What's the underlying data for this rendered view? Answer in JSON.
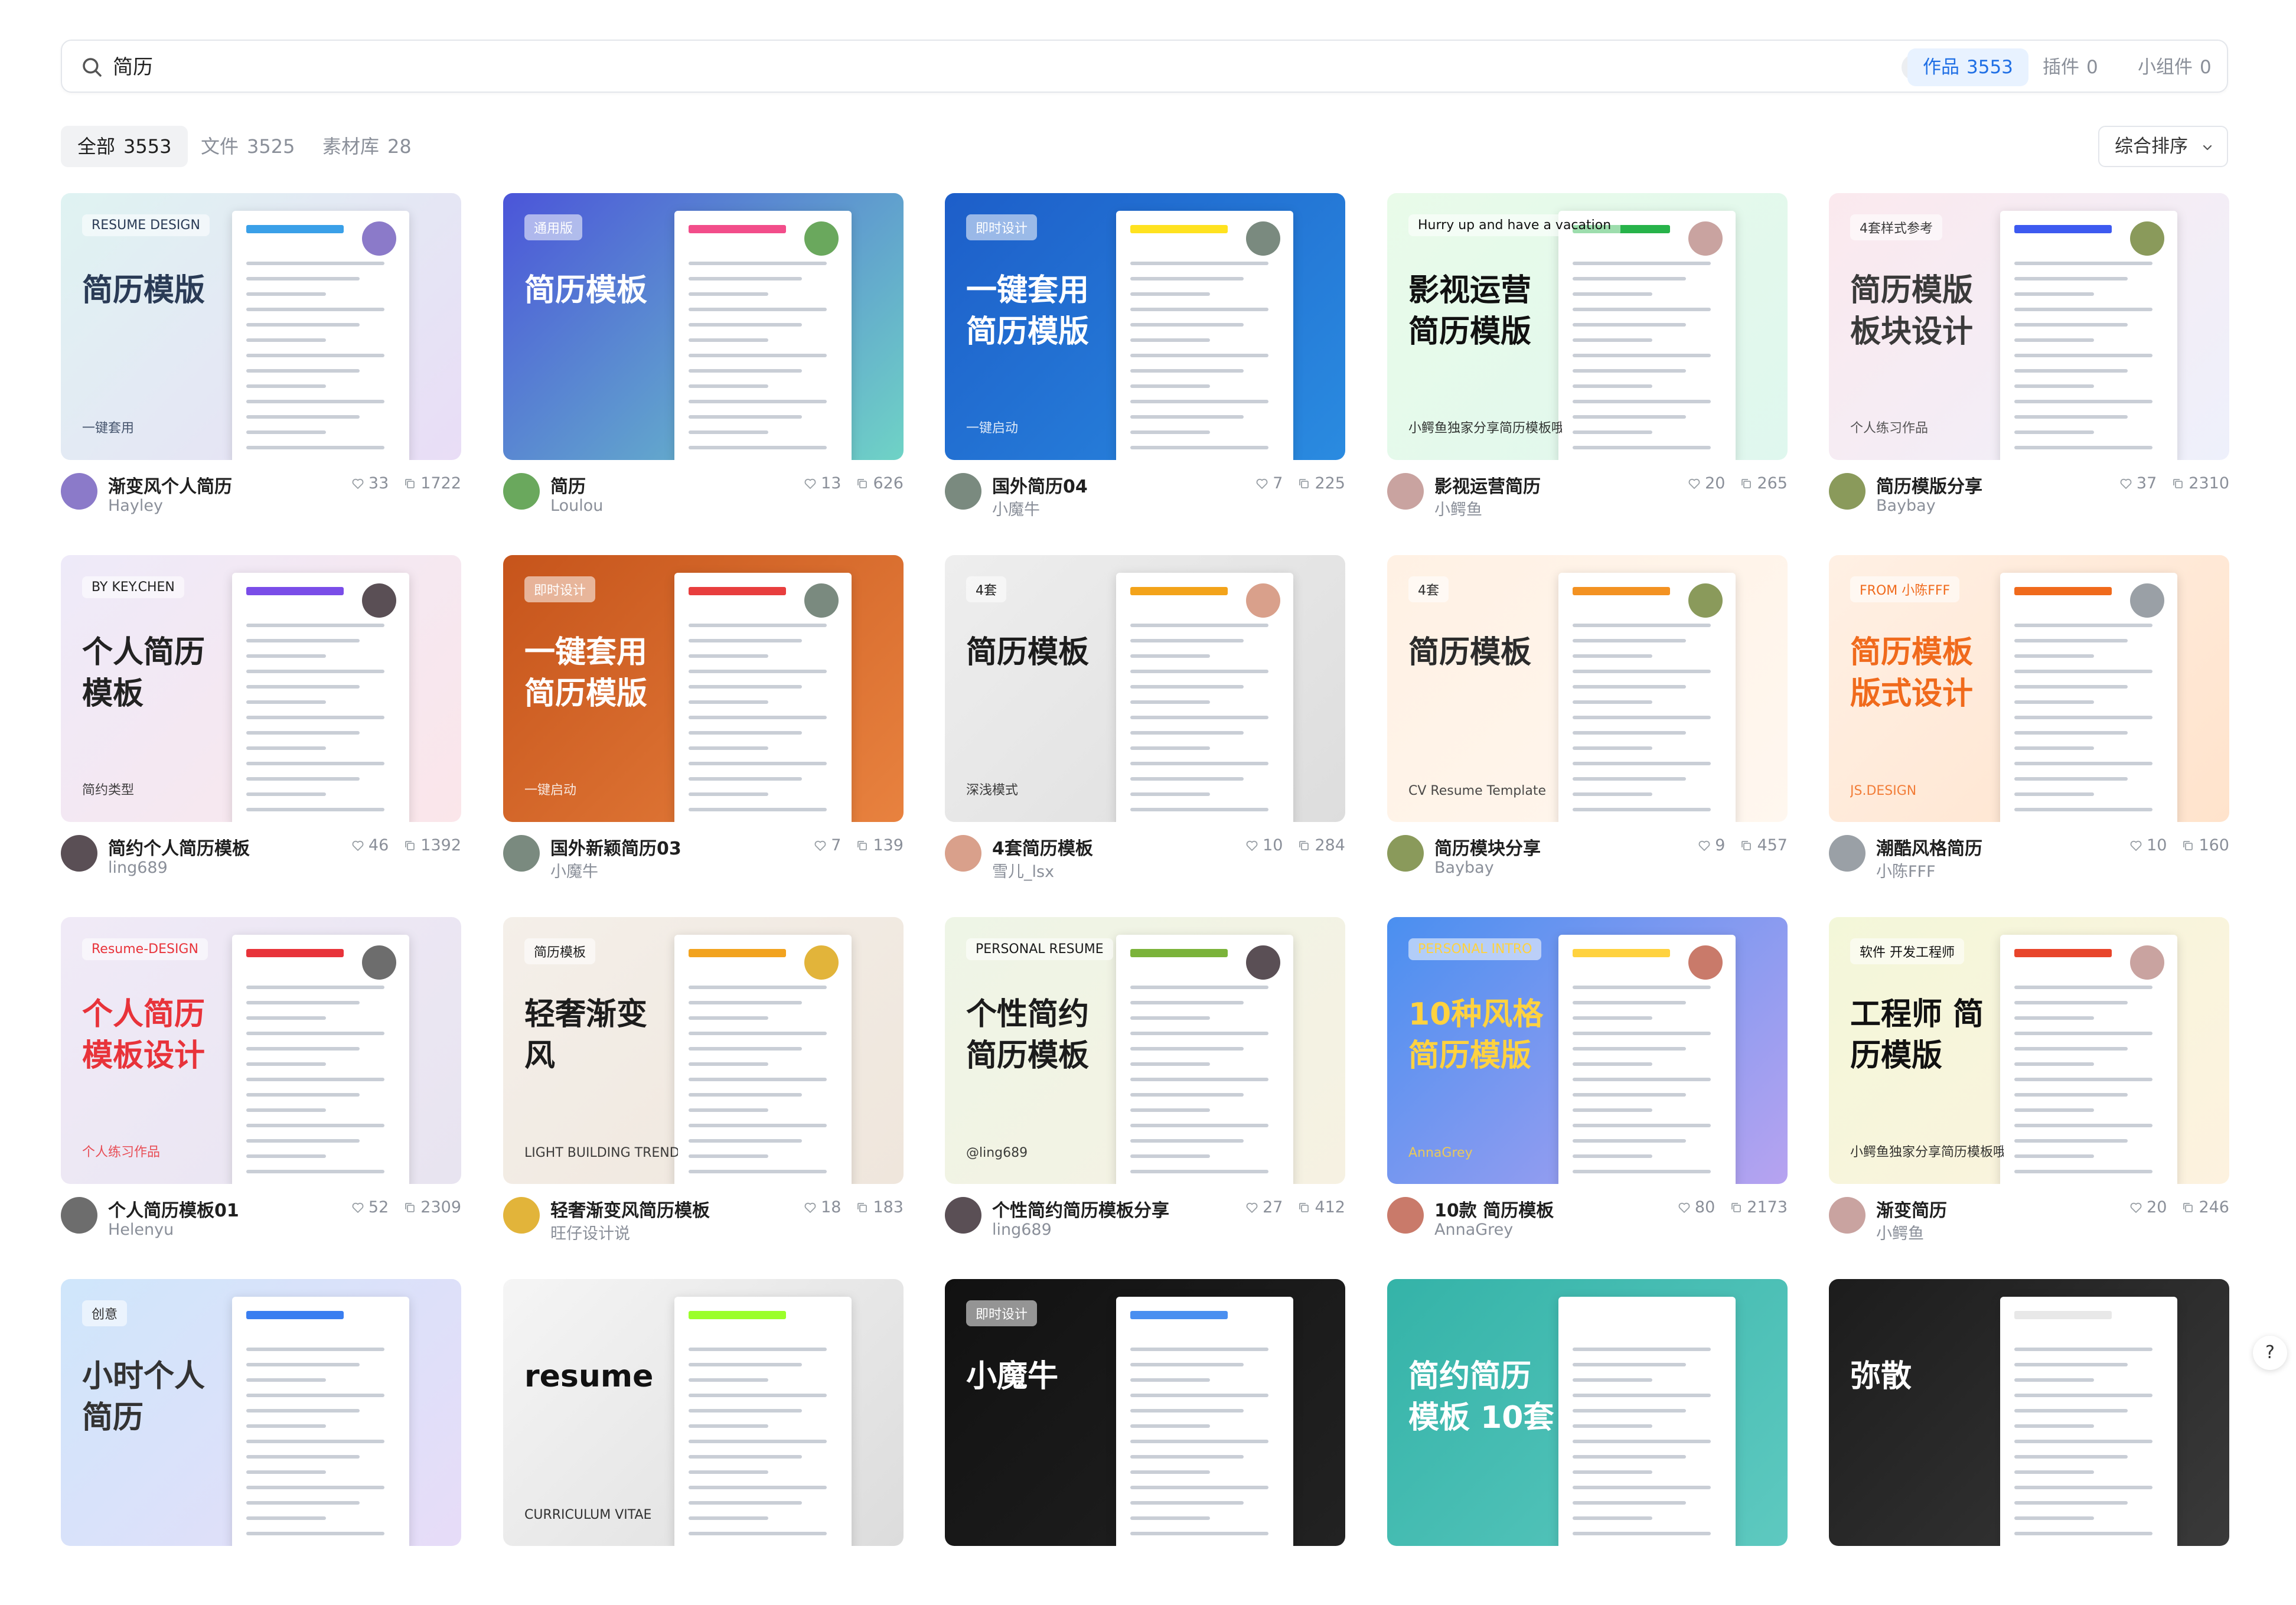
{
  "search": {
    "query": "简历",
    "scopes": [
      {
        "label": "作品",
        "count": "3553",
        "active": true
      },
      {
        "label": "插件",
        "count": "0",
        "active": false
      },
      {
        "label": "小组件",
        "count": "0",
        "active": false
      }
    ]
  },
  "filters": {
    "tabs": [
      {
        "label": "全部",
        "count": "3553",
        "active": true
      },
      {
        "label": "文件",
        "count": "3525",
        "active": false
      },
      {
        "label": "素材库",
        "count": "28",
        "active": false
      }
    ],
    "sort_label": "综合排序"
  },
  "colors": {
    "accent": "#1f6fe5",
    "muted": "#8a8f99"
  },
  "cards": [
    {
      "title": "渐变风个人简历",
      "author": "Hayley",
      "likes": "33",
      "copies": "1722",
      "thumb_text": "简历模版",
      "thumb_sub": "一键套用",
      "thumb_tag": "RESUME DESIGN",
      "bg1": "#dff3f2",
      "bg2": "#e9ddf6",
      "ink": "#2a3b56",
      "accent": "#3aa0e8",
      "avatar": "#8b7ac9"
    },
    {
      "title": "简历",
      "author": "Loulou",
      "likes": "13",
      "copies": "626",
      "thumb_text": "简历模板",
      "thumb_sub": "",
      "thumb_tag": "通用版",
      "bg1": "#4b55d9",
      "bg2": "#6fd3c6",
      "ink": "#ffffff",
      "accent": "#f24d8a",
      "avatar": "#6aa85d"
    },
    {
      "title": "国外简历04",
      "author": "小魔牛",
      "likes": "7",
      "copies": "225",
      "thumb_text": "一键套用 简历模版",
      "thumb_sub": "一键启动",
      "thumb_tag": "即时设计",
      "bg1": "#1d5ec9",
      "bg2": "#2a8be0",
      "ink": "#ffffff",
      "accent": "#ffe21f",
      "avatar": "#7a8a7f"
    },
    {
      "title": "影视运营简历",
      "author": "小鳄鱼",
      "likes": "20",
      "copies": "265",
      "thumb_text": "影视运营 简历模版",
      "thumb_sub": "小鳄鱼独家分享简历模板哦",
      "thumb_tag": "Hurry up and have a vacation",
      "bg1": "#e9fbe9",
      "bg2": "#dff7ee",
      "ink": "#111111",
      "accent": "#27b34a",
      "avatar": "#c9a3a0"
    },
    {
      "title": "简历模版分享",
      "author": "Baybay",
      "likes": "37",
      "copies": "2310",
      "thumb_text": "简历模版 板块设计",
      "thumb_sub": "个人练习作品",
      "thumb_tag": "4套样式参考",
      "bg1": "#fbe9ee",
      "bg2": "#eef0fb",
      "ink": "#3a3a3a",
      "accent": "#3d5af0",
      "avatar": "#8a9a5b"
    },
    {
      "title": "简约个人简历模板",
      "author": "ling689",
      "likes": "46",
      "copies": "1392",
      "thumb_text": "个人简历 模板",
      "thumb_sub": "简约类型",
      "thumb_tag": "BY KEY.CHEN",
      "bg1": "#eeeaf9",
      "bg2": "#fbe6ea",
      "ink": "#222222",
      "accent": "#7a4de8",
      "avatar": "#5a4f55"
    },
    {
      "title": "国外新颖简历03",
      "author": "小魔牛",
      "likes": "7",
      "copies": "139",
      "thumb_text": "一键套用 简历模版",
      "thumb_sub": "一键启动",
      "thumb_tag": "即时设计",
      "bg1": "#c6541b",
      "bg2": "#e8823f",
      "ink": "#ffffff",
      "accent": "#e83e3e",
      "avatar": "#7a8a7f"
    },
    {
      "title": "4套简历模板",
      "author": "雪儿_lsx",
      "likes": "10",
      "copies": "284",
      "thumb_text": "简历模板",
      "thumb_sub": "深浅模式",
      "thumb_tag": "4套",
      "bg1": "#eeeeee",
      "bg2": "#dddddd",
      "ink": "#1c1c1c",
      "accent": "#f3a31a",
      "avatar": "#d9a08b"
    },
    {
      "title": "简历模块分享",
      "author": "Baybay",
      "likes": "9",
      "copies": "457",
      "thumb_text": "简历模板",
      "thumb_sub": "CV Resume Template",
      "thumb_tag": "4套",
      "bg1": "#fff1e4",
      "bg2": "#fff7ef",
      "ink": "#2b2b2b",
      "accent": "#f39222",
      "avatar": "#8a9a5b"
    },
    {
      "title": "潮酷风格简历",
      "author": "小陈FFF",
      "likes": "10",
      "copies": "160",
      "thumb_text": "简历模板 版式设计",
      "thumb_sub": "JS.DESIGN",
      "thumb_tag": "FROM 小陈FFF",
      "bg1": "#fff0e4",
      "bg2": "#ffe3cc",
      "ink": "#f06a1c",
      "accent": "#f06a1c",
      "avatar": "#9aa0a6"
    },
    {
      "title": "个人简历模板01",
      "author": "Helenyu",
      "likes": "52",
      "copies": "2309",
      "thumb_text": "个人简历 模板设计",
      "thumb_sub": "个人练习作品",
      "thumb_tag": "Resume-DESIGN",
      "bg1": "#f0eaf7",
      "bg2": "#e8e4f0",
      "ink": "#e8333a",
      "accent": "#e8333a",
      "avatar": "#6d6d6d"
    },
    {
      "title": "轻奢渐变风简历模板",
      "author": "旺仔设计说",
      "likes": "18",
      "copies": "183",
      "thumb_text": "轻奢渐变风",
      "thumb_sub": "LIGHT BUILDING TREND | RESUME TEMPLATE",
      "thumb_tag": "简历模板",
      "bg1": "#f4efe9",
      "bg2": "#efe6dc",
      "ink": "#1c1c1c",
      "accent": "#f2a31f",
      "avatar": "#e2b43a"
    },
    {
      "title": "个性简约简历模板分享",
      "author": "ling689",
      "likes": "27",
      "copies": "412",
      "thumb_text": "个性简约 简历模板",
      "thumb_sub": "@ling689",
      "thumb_tag": "PERSONAL RESUME",
      "bg1": "#eef5e6",
      "bg2": "#f6f1e2",
      "ink": "#1c1c1c",
      "accent": "#7bb33a",
      "avatar": "#5a4f55"
    },
    {
      "title": "10款 简历模板",
      "author": "AnnaGrey",
      "likes": "80",
      "copies": "2173",
      "thumb_text": "10种风格 简历模版",
      "thumb_sub": "AnnaGrey",
      "thumb_tag": "PERSONAL INTRO",
      "bg1": "#4a8ff0",
      "bg2": "#b7a3f0",
      "ink": "#ffd23f",
      "accent": "#ffd23f",
      "avatar": "#c97a6a"
    },
    {
      "title": "渐变简历",
      "author": "小鳄鱼",
      "likes": "20",
      "copies": "246",
      "thumb_text": "工程师 简历模版",
      "thumb_sub": "小鳄鱼独家分享简历模板哦",
      "thumb_tag": "软件 开发工程师",
      "bg1": "#f3f7d9",
      "bg2": "#fdf2df",
      "ink": "#111111",
      "accent": "#e8452b",
      "avatar": "#c9a3a0"
    },
    {
      "title": "",
      "author": "",
      "likes": "",
      "copies": "",
      "thumb_text": "小时个人简历",
      "thumb_sub": "",
      "thumb_tag": "创意",
      "bg1": "#cfe6fb",
      "bg2": "#e7dcf8",
      "ink": "#333333",
      "accent": "#3a7ef0",
      "avatar": "#ffffff"
    },
    {
      "title": "",
      "author": "",
      "likes": "",
      "copies": "",
      "thumb_text": "resume",
      "thumb_sub": "CURRICULUM VITAE",
      "thumb_tag": "",
      "bg1": "#f5f5f5",
      "bg2": "#dcdcdc",
      "ink": "#111111",
      "accent": "#9bff2a",
      "avatar": "#ffffff"
    },
    {
      "title": "",
      "author": "",
      "likes": "",
      "copies": "",
      "thumb_text": "小魔牛",
      "thumb_sub": "",
      "thumb_tag": "即时设计",
      "bg1": "#111111",
      "bg2": "#222222",
      "ink": "#ffffff",
      "accent": "#4a8ff0",
      "avatar": "#ffffff"
    },
    {
      "title": "",
      "author": "",
      "likes": "",
      "copies": "",
      "thumb_text": "简约简历模板 10套",
      "thumb_sub": "",
      "thumb_tag": "",
      "bg1": "#34b3a8",
      "bg2": "#5ec9c0",
      "ink": "#ffffff",
      "accent": "#ffffff",
      "avatar": "#ffffff"
    },
    {
      "title": "",
      "author": "",
      "likes": "",
      "copies": "",
      "thumb_text": "弥散",
      "thumb_sub": "",
      "thumb_tag": "",
      "bg1": "#1c1c1c",
      "bg2": "#3a3a3a",
      "ink": "#ffffff",
      "accent": "#e8e8e8",
      "avatar": "#ffffff"
    }
  ],
  "help_label": "?"
}
